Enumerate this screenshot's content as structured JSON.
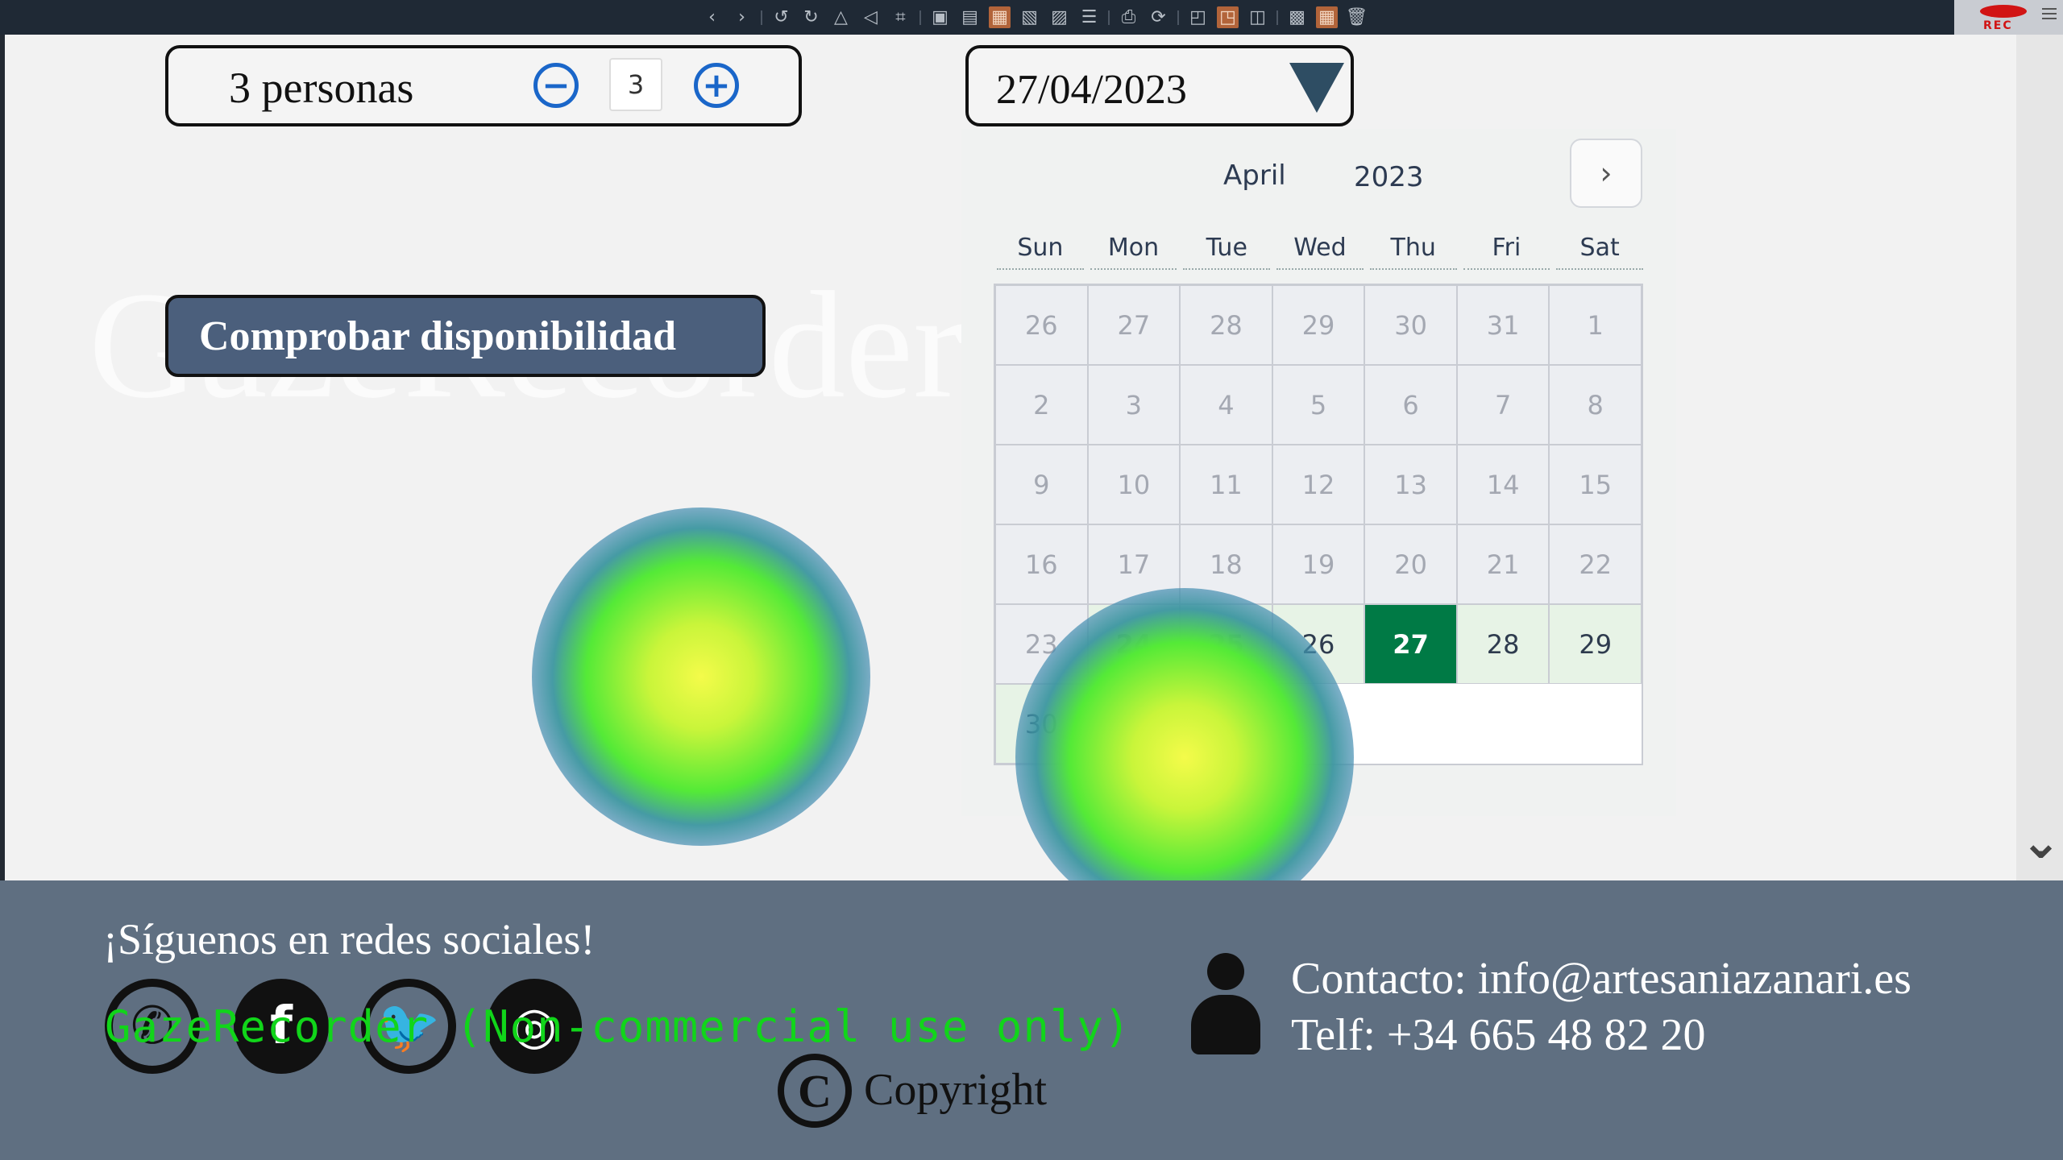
{
  "toolbar": {
    "icons": [
      "chevron-left-icon",
      "chevron-right-icon",
      "undo-icon",
      "redo-icon",
      "flip-icon",
      "flip-horizontal-icon",
      "crop-icon",
      "image-icon",
      "lock-icon",
      "active-frame-icon",
      "frame-icon",
      "frame-alt-icon",
      "print-icon",
      "refresh-icon",
      "resize-icon",
      "active-resize-icon",
      "gallery-icon",
      "image-alt-icon",
      "grid-icon",
      "trash-icon"
    ],
    "rec_label": "REC"
  },
  "booking": {
    "people_label": "3 personas",
    "quantity": "3",
    "minus_symbol": "−",
    "plus_symbol": "+",
    "date_value": "27/04/2023",
    "check_button": "Comprobar disponibilidad"
  },
  "watermark": "GazeRecorder",
  "calendar": {
    "month": "April",
    "year": "2023",
    "next_symbol": "›",
    "weekdays": [
      "Sun",
      "Mon",
      "Tue",
      "Wed",
      "Thu",
      "Fri",
      "Sat"
    ],
    "selected_day": "27",
    "days": [
      [
        "26",
        "disabled"
      ],
      [
        "27",
        "disabled"
      ],
      [
        "28",
        "disabled"
      ],
      [
        "29",
        "disabled"
      ],
      [
        "30",
        "disabled"
      ],
      [
        "31",
        "disabled"
      ],
      [
        "1",
        "disabled"
      ],
      [
        "2",
        "disabled"
      ],
      [
        "3",
        "disabled"
      ],
      [
        "4",
        "disabled"
      ],
      [
        "5",
        "disabled"
      ],
      [
        "6",
        "disabled"
      ],
      [
        "7",
        "disabled"
      ],
      [
        "8",
        "disabled"
      ],
      [
        "9",
        "disabled"
      ],
      [
        "10",
        "disabled"
      ],
      [
        "11",
        "disabled"
      ],
      [
        "12",
        "disabled"
      ],
      [
        "13",
        "disabled"
      ],
      [
        "14",
        "disabled"
      ],
      [
        "15",
        "disabled"
      ],
      [
        "16",
        "disabled"
      ],
      [
        "17",
        "disabled"
      ],
      [
        "18",
        "disabled"
      ],
      [
        "19",
        "disabled"
      ],
      [
        "20",
        "disabled"
      ],
      [
        "21",
        "disabled"
      ],
      [
        "22",
        "disabled"
      ],
      [
        "23",
        "disabled"
      ],
      [
        "24",
        "avail"
      ],
      [
        "25",
        "avail"
      ],
      [
        "26",
        "avail"
      ],
      [
        "27",
        "selected"
      ],
      [
        "28",
        "avail"
      ],
      [
        "29",
        "avail"
      ],
      [
        "30",
        "avail"
      ],
      [
        "",
        "empty"
      ],
      [
        "",
        "empty"
      ],
      [
        "",
        "empty"
      ],
      [
        "",
        "empty"
      ],
      [
        "",
        "empty"
      ],
      [
        "",
        "empty"
      ]
    ]
  },
  "footer": {
    "follow_us": "¡Síguenos en redes sociales!",
    "gaze_notice": "GazeRecorder (Non-commercial use only)",
    "copyright": "Copyright",
    "copyright_symbol": "C",
    "contact": "Contacto: info@artesaniazanari.es",
    "phone": "Telf: +34 665 48 82 20",
    "social": [
      "whatsapp-icon",
      "facebook-icon",
      "twitter-icon",
      "instagram-icon"
    ]
  },
  "colors": {
    "footer_bg": "#5f6f81",
    "selected_day": "#007a45",
    "available_day": "#e7f3e6",
    "button_bg": "#4b5f7c",
    "stepper": "#1a66c9",
    "gaze_text": "#11d51a"
  }
}
